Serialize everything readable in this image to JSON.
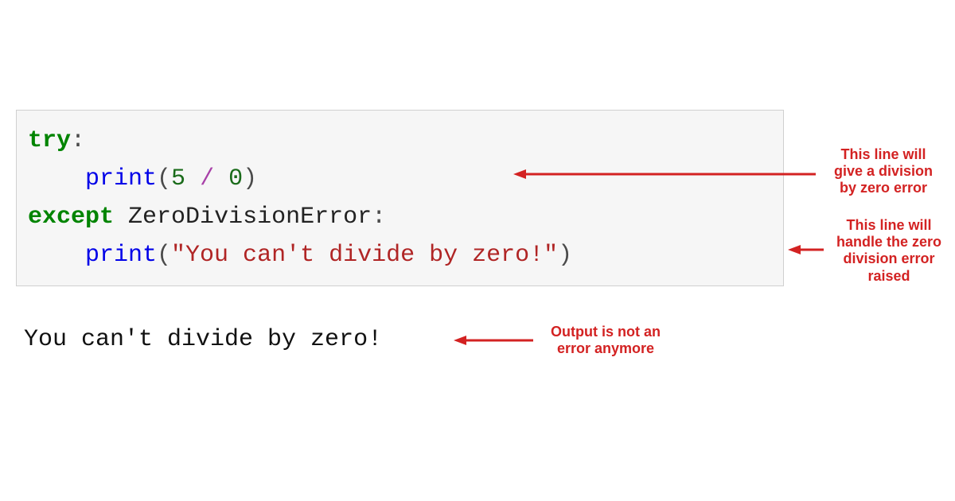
{
  "code": {
    "l1_try": "try",
    "colon1": ":",
    "l2_print": "print",
    "l2_open": "(",
    "l2_a": "5",
    "l2_op": "/",
    "l2_b": "0",
    "l2_close": ")",
    "l3_except": "except",
    "l3_exc": "ZeroDivisionError",
    "colon2": ":",
    "l4_print": "print",
    "l4_open": "(",
    "l4_str": "\"You can't divide by zero!\"",
    "l4_close": ")"
  },
  "output": "You can't divide by zero!",
  "annotations": {
    "a1": "This line will\ngive a division\nby zero error",
    "a2": "This line will\nhandle the zero\ndivision error\nraised",
    "a3": "Output is not an\nerror anymore"
  },
  "colors": {
    "annotation": "#d32222"
  }
}
